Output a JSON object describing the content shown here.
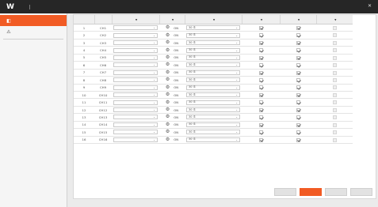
{
  "top_menu": {
    "logo": "W",
    "items": [
      {
        "label": ""
      },
      {
        "label": ""
      },
      {
        "label": ""
      },
      {
        "label": ""
      },
      {
        "label": ""
      },
      {
        "label": ""
      },
      {
        "label": ""
      }
    ],
    "active_index": 3,
    "close_icon": "close-icon"
  },
  "sidebar": {
    "items": [
      {
        "label": "",
        "icon": "camera-settings-icon",
        "active": true
      },
      {
        "label": "",
        "icon": "warning-icon",
        "active": false
      }
    ]
  },
  "table": {
    "headers": [
      "",
      "",
      "",
      "",
      "",
      "",
      "",
      ""
    ],
    "rows": [
      {
        "no": "1",
        "channel": "CH1",
        "mode": "",
        "audio": "ON",
        "rate": "30 초"
      },
      {
        "no": "2",
        "channel": "CH2",
        "mode": "",
        "audio": "ON",
        "rate": "30 초"
      },
      {
        "no": "3",
        "channel": "CH3",
        "mode": "",
        "audio": "ON",
        "rate": "30 초"
      },
      {
        "no": "4",
        "channel": "CH4",
        "mode": "",
        "audio": "ON",
        "rate": "30 초"
      },
      {
        "no": "5",
        "channel": "CH5",
        "mode": "",
        "audio": "ON",
        "rate": "30 초"
      },
      {
        "no": "6",
        "channel": "CH6",
        "mode": "",
        "audio": "ON",
        "rate": "30 초"
      },
      {
        "no": "7",
        "channel": "CH7",
        "mode": "",
        "audio": "ON",
        "rate": "30 초"
      },
      {
        "no": "8",
        "channel": "CH8",
        "mode": "",
        "audio": "ON",
        "rate": "30 초"
      },
      {
        "no": "9",
        "channel": "CH9",
        "mode": "",
        "audio": "ON",
        "rate": "30 초"
      },
      {
        "no": "10",
        "channel": "CH10",
        "mode": "",
        "audio": "ON",
        "rate": "30 초"
      },
      {
        "no": "11",
        "channel": "CH11",
        "mode": "",
        "audio": "ON",
        "rate": "30 초"
      },
      {
        "no": "12",
        "channel": "CH12",
        "mode": "",
        "audio": "ON",
        "rate": "30 초"
      },
      {
        "no": "13",
        "channel": "CH13",
        "mode": "",
        "audio": "ON",
        "rate": "30 초"
      },
      {
        "no": "14",
        "channel": "CH14",
        "mode": "",
        "audio": "ON",
        "rate": "30 초"
      },
      {
        "no": "15",
        "channel": "CH15",
        "mode": "",
        "audio": "ON",
        "rate": "30 초"
      },
      {
        "no": "16",
        "channel": "CH16",
        "mode": "",
        "audio": "ON",
        "rate": "30 초"
      }
    ],
    "checkbox_states": {
      "col_a": true,
      "col_b": true,
      "col_c": false
    }
  },
  "buttons": {
    "prev": "",
    "ok": "",
    "close": "",
    "apply": ""
  },
  "colors": {
    "accent": "#f15b24",
    "topbar": "#262626"
  }
}
